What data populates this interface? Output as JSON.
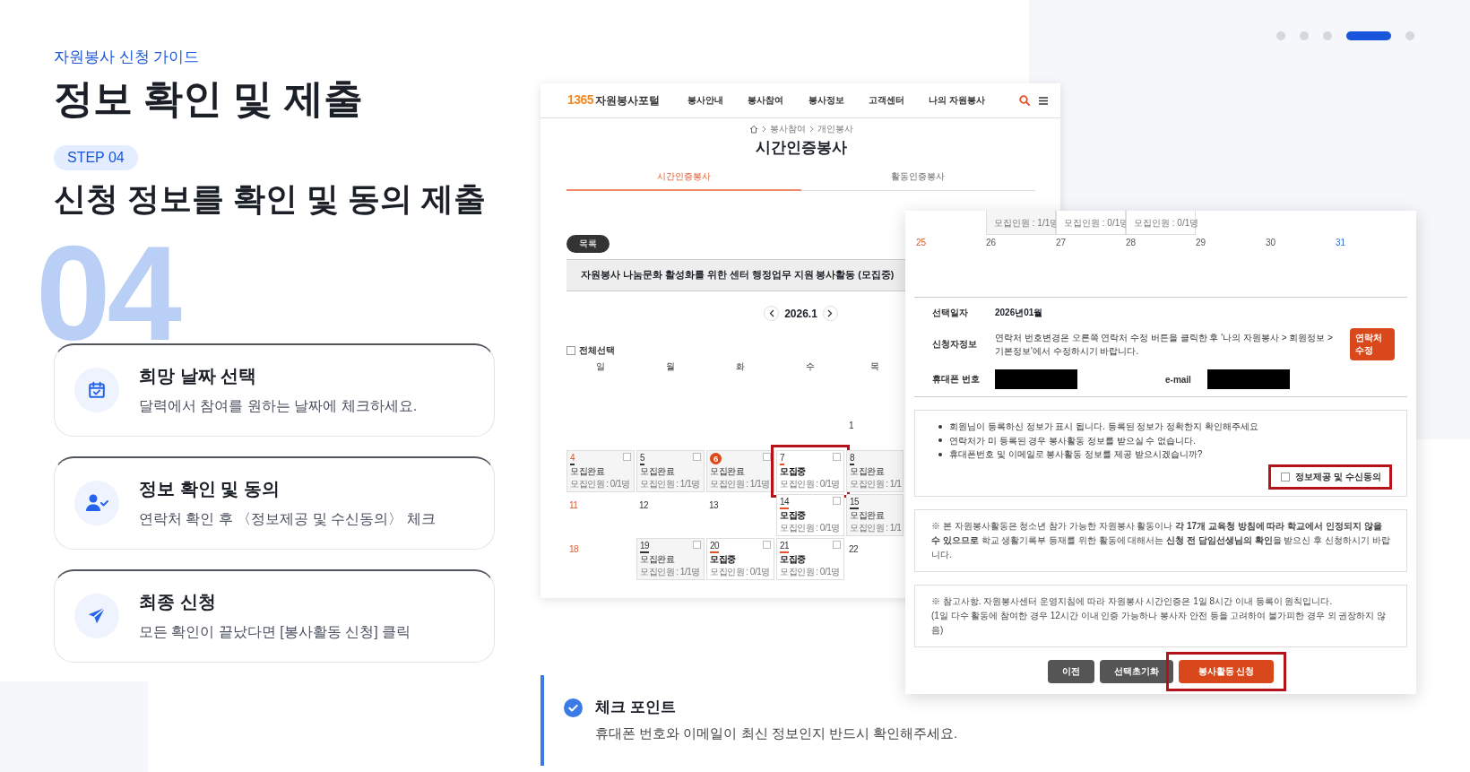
{
  "eyebrow": "자원봉사 신청 가이드",
  "title": "정보 확인 및 제출",
  "step_badge": "STEP 04",
  "big_number": "04",
  "subtitle": "신청 정보를 확인 및 동의 제출",
  "pager": [
    {
      "selected": false
    },
    {
      "selected": false
    },
    {
      "selected": false
    },
    {
      "selected": true
    },
    {
      "selected": false
    }
  ],
  "steps": [
    {
      "kind": "calendar",
      "title": "희망 날짜 선택",
      "description": "달력에서 참여를 원하는 날짜에 체크하세요."
    },
    {
      "kind": "user",
      "title": "정보 확인 및 동의",
      "description": "연락처 확인 후 〈정보제공 및 수신동의〉 체크"
    },
    {
      "kind": "send",
      "title": "최종 신청",
      "description": "모든 확인이 끝났다면 [봉사활동 신청] 클릭"
    }
  ],
  "portal": {
    "logo_number": "1365",
    "logo_text": "자원봉사포털",
    "nav": [
      "봉사안내",
      "봉사참여",
      "봉사정보",
      "고객센터",
      "나의 자원봉사"
    ],
    "breadcrumb": [
      "봉사참여",
      "개인봉사"
    ],
    "page_title": "시간인증봉사",
    "tabs": [
      {
        "label": "시간인증봉사",
        "selected": true
      },
      {
        "label": "활동인증봉사",
        "selected": false
      }
    ],
    "list_button": "목록",
    "activity_title": "자원봉사 나눔문화 활성화를 위한 센터 행정업무 지원 봉사활동 (모집중)",
    "month": "2026.1",
    "select_all": {
      "label": "전체선택",
      "checked": false
    },
    "weekdays": [
      "일",
      "월",
      "화",
      "수",
      "목"
    ],
    "weeks": [
      [
        {
          "kind": "blank"
        },
        {
          "kind": "blank"
        },
        {
          "kind": "blank"
        },
        {
          "kind": "blank"
        },
        {
          "kind": "plain",
          "day": "1"
        }
      ],
      [
        {
          "kind": "closed",
          "day": "4",
          "status": "모집완료",
          "count": "모집인원 : 0/1명",
          "checked": false,
          "today": false,
          "highlighted": false
        },
        {
          "kind": "closed",
          "day": "5",
          "status": "모집완료",
          "count": "모집인원 : 1/1명",
          "checked": false,
          "today": false,
          "highlighted": false
        },
        {
          "kind": "closed",
          "day": "6",
          "status": "모집완료",
          "count": "모집인원 : 1/1명",
          "checked": false,
          "today": true,
          "highlighted": false
        },
        {
          "kind": "open",
          "day": "7",
          "status": "모집중",
          "count": "모집인원 : 0/1명",
          "checked": false,
          "today": false,
          "highlighted": true
        },
        {
          "kind": "closed",
          "day": "8",
          "status": "모집완료",
          "count": "모집인원 : 1/1",
          "today": false,
          "highlighted": false
        }
      ],
      [
        {
          "kind": "plain",
          "day": "11"
        },
        {
          "kind": "plain",
          "day": "12"
        },
        {
          "kind": "plain",
          "day": "13"
        },
        {
          "kind": "open",
          "day": "14",
          "status": "모집중",
          "count": "모집인원 : 0/1명",
          "checked": false,
          "today": false,
          "highlighted": false
        },
        {
          "kind": "closed",
          "day": "15",
          "status": "모집완료",
          "count": "모집인원 : 1/1",
          "today": false,
          "highlighted": false
        }
      ],
      [
        {
          "kind": "plain",
          "day": "18"
        },
        {
          "kind": "closed",
          "day": "19",
          "status": "모집완료",
          "count": "모집인원 : 1/1명",
          "checked": false,
          "today": false,
          "highlighted": false
        },
        {
          "kind": "open",
          "day": "20",
          "status": "모집중",
          "count": "모집인원 : 0/1명",
          "checked": false,
          "today": false,
          "highlighted": false
        },
        {
          "kind": "open",
          "day": "21",
          "status": "모집중",
          "count": "모집인원 : 0/1명",
          "checked": false,
          "today": false,
          "highlighted": false
        },
        {
          "kind": "plain",
          "day": "22"
        }
      ]
    ]
  },
  "form": {
    "top_cells": [
      {
        "kind": "closed",
        "count": "모집인원 : 1/1명"
      },
      {
        "kind": "open",
        "count": "모집인원 : 0/1명"
      },
      {
        "kind": "open",
        "count": "모집인원 : 0/1명"
      }
    ],
    "days": [
      "25",
      "26",
      "27",
      "28",
      "29",
      "30",
      "31"
    ],
    "selected_date": {
      "label": "선택일자",
      "value": "2026년01월"
    },
    "applicant": {
      "label": "신청자정보",
      "note": "연락처 번호변경은 오른쪽 연락처 수정 버튼을 클릭한 후 '나의 자원봉사 > 회원정보 > 기본정보'에서 수정하시기 바랍니다.",
      "edit_button": "연락처 수정"
    },
    "phone_label": "휴대폰 번호",
    "email_label": "e-mail",
    "notices": [
      "회원님이 등록하신 정보가 표시 됩니다. 등록된 정보가 정확한지 확인해주세요",
      "연락처가 미 등록된 경우 봉사활동 정보를 받으실 수 없습니다.",
      "휴대폰번호 및 이메일로 봉사활동 정보를 제공 받으시겠습니까?"
    ],
    "consent": {
      "label": "정보제공 및 수신동의",
      "checked": false,
      "highlighted": true
    },
    "school_notice": "※ 본 자원봉사활동은 청소년 참가 가능한 자원봉사 활동이나 **각 17개 교육청 방침에 따라 학교에서 인정되지 않을 수 있으므로** 학교 생활기록부 등재를 위한 활동에 대해서는 **신청 전 담임선생님의 확인**을 받으신 후 신청하시기 바랍니다.",
    "reference": [
      "※ 참고사항. 자원봉사센터 운영지침에 따라 자원봉사 시간인증은 1일 8시간 이내 등록이 원칙입니다.",
      "(1일 다수 활동에 참여한 경우 12시간 이내 인증 가능하나 봉사자 안전 등을 고려하여 불가피한 경우 외 권장하지 않음)"
    ],
    "buttons": [
      {
        "label": "이전",
        "kind": "secondary",
        "highlighted": false
      },
      {
        "label": "선택초기화",
        "kind": "secondary",
        "highlighted": false
      },
      {
        "label": "봉사활동 신청",
        "kind": "primary",
        "highlighted": true
      }
    ]
  },
  "check_point": {
    "title": "체크 포인트",
    "text": "휴대폰 번호와 이메일이 최신 정보인지 반드시 확인해주세요."
  }
}
